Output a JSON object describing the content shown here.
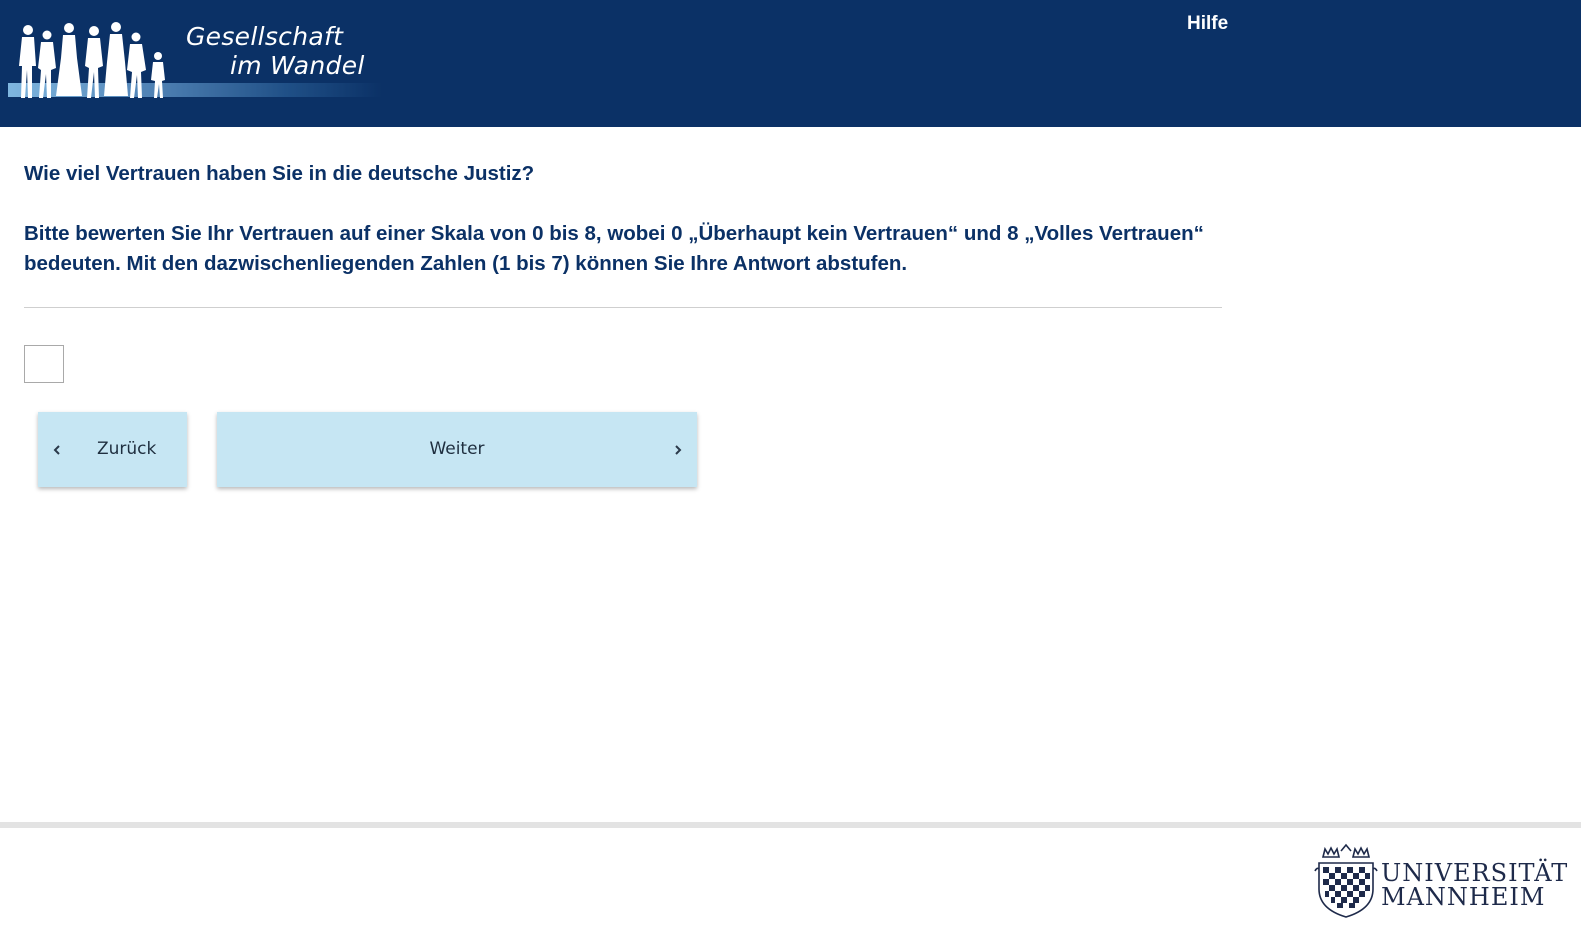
{
  "header": {
    "logo": {
      "line1": "Gesellschaft",
      "line2": "im Wandel"
    },
    "help_label": "Hilfe"
  },
  "question": {
    "title": "Wie viel Vertrauen haben Sie in die deutsche Justiz?",
    "instruction": "Bitte bewerten Sie Ihr Vertrauen auf einer Skala von 0 bis 8, wobei 0 „Überhaupt kein Vertrauen“ und 8 „Volles Vertrauen“ bedeuten. Mit den dazwischenliegenden Zahlen (1 bis 7) können Sie Ihre Antwort abstufen."
  },
  "answer": {
    "value": ""
  },
  "navigation": {
    "back_label": "Zurück",
    "next_label": "Weiter"
  },
  "footer": {
    "university_line1": "UNIVERSITÄT",
    "university_line2": "MANNHEIM"
  },
  "icons": {
    "back": "chevron-left-icon",
    "next": "chevron-right-icon",
    "seal": "university-seal-icon"
  },
  "colors": {
    "header_bg": "#0b3166",
    "question_text": "#0b3166",
    "button_bg": "#c6e6f3"
  }
}
